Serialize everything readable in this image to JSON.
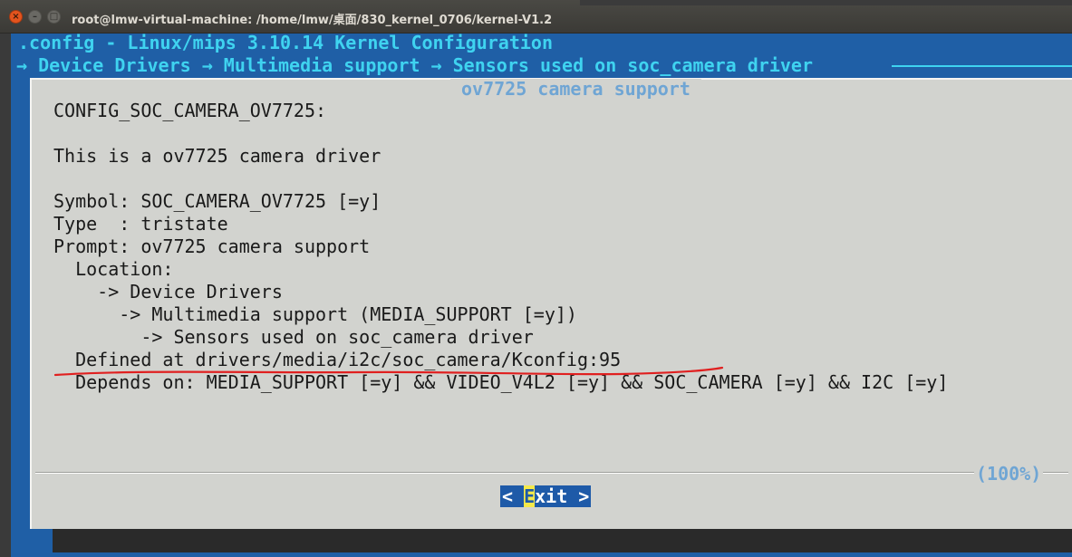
{
  "window": {
    "title": "root@lmw-virtual-machine: /home/lmw/桌面/830_kernel_0706/kernel-V1.2",
    "close_glyph": "×",
    "minimize_glyph": "–",
    "maximize_glyph": "□"
  },
  "header": {
    "config_title": ".config - Linux/mips 3.10.14 Kernel Configuration",
    "breadcrumb": "→ Device Drivers → Multimedia support → Sensors used on soc_camera driver"
  },
  "dialog": {
    "title": "ov7725 camera support",
    "lines": [
      "CONFIG_SOC_CAMERA_OV7725:",
      "",
      "This is a ov7725 camera driver",
      "",
      "Symbol: SOC_CAMERA_OV7725 [=y]",
      "Type  : tristate",
      "Prompt: ov7725 camera support",
      "  Location:",
      "    -> Device Drivers",
      "      -> Multimedia support (MEDIA_SUPPORT [=y])",
      "        -> Sensors used on soc_camera driver",
      "  Defined at drivers/media/i2c/soc_camera/Kconfig:95",
      "  Depends on: MEDIA_SUPPORT [=y] && VIDEO_V4L2 [=y] && SOC_CAMERA [=y] && I2C [=y]"
    ],
    "scroll_percent": "(100%)",
    "exit_button": {
      "left": "< ",
      "hotkey": "E",
      "rest": "xit >"
    }
  },
  "colors": {
    "terminal_bg": "#1f5fa6",
    "header_text": "#3fd3f0",
    "dialog_bg": "#d2d3cf",
    "dialog_title": "#6fa5d4",
    "annotation_red": "#e02020",
    "exit_hotkey_bg": "#f4e94a"
  }
}
